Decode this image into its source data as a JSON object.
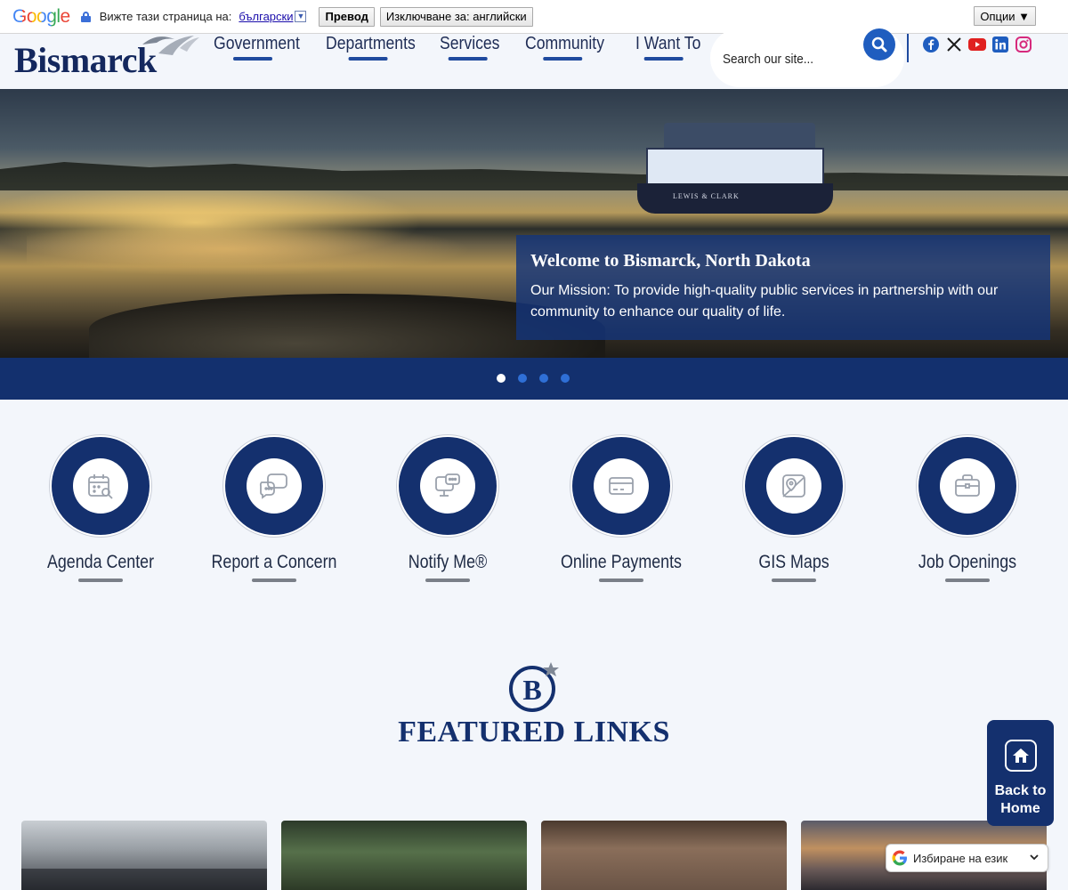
{
  "translate_bar": {
    "logo": "Google",
    "prompt": "Вижте тази страница на:",
    "language": "български",
    "translate_button": "Превод",
    "exclude_button": "Изключване за: английски",
    "options_button": "Опции ▼"
  },
  "header": {
    "logo_text": "Bismarck",
    "nav": [
      "Government",
      "Departments",
      "Services",
      "Community",
      "I Want To"
    ],
    "search_placeholder": "Search our site...",
    "socials": [
      "facebook-icon",
      "x-icon",
      "youtube-icon",
      "linkedin-icon",
      "instagram-icon"
    ]
  },
  "hero": {
    "boat_name": "LEWIS & CLARK",
    "title": "Welcome to Bismarck, North Dakota",
    "mission": "Our Mission: To provide high-quality public services in partnership with our community to enhance our quality of life.",
    "slide_count": 4,
    "active_slide": 1
  },
  "quick_links": [
    {
      "label": "Agenda Center",
      "icon": "calendar-search-icon"
    },
    {
      "label": "Report a Concern",
      "icon": "chat-bubbles-icon"
    },
    {
      "label": "Notify Me®",
      "icon": "monitor-chat-icon"
    },
    {
      "label": "Online Payments",
      "icon": "credit-card-icon"
    },
    {
      "label": "GIS Maps",
      "icon": "map-pin-icon"
    },
    {
      "label": "Job Openings",
      "icon": "briefcase-icon"
    }
  ],
  "featured": {
    "emblem_letter": "B",
    "title": "FEATURED LINKS"
  },
  "back_to_home": {
    "line1": "Back to",
    "line2": "Home"
  },
  "language_selector": {
    "label": "Избиране на език"
  },
  "colors": {
    "brand_navy": "#14306e",
    "accent_blue": "#1f5dbf",
    "page_bg": "#f3f6fb"
  }
}
